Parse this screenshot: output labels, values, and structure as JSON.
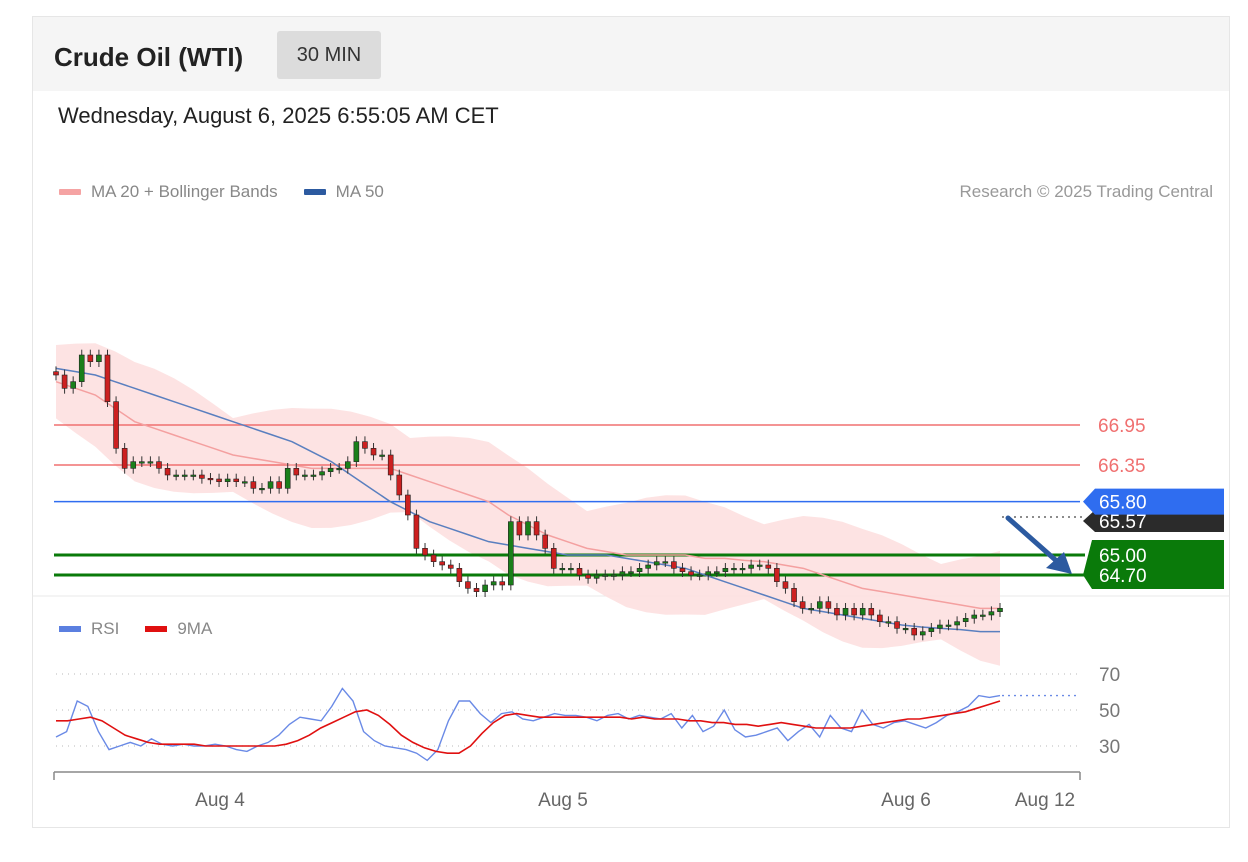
{
  "header": {
    "title": "Crude Oil (WTI)",
    "timeframe": "30 MIN"
  },
  "datetime": "Wednesday, August 6, 2025 6:55:05 AM CET",
  "legend": {
    "ma20": {
      "label": "MA 20 + Bollinger Bands",
      "color": "#f08080"
    },
    "ma50": {
      "label": "MA 50",
      "color": "#2c5aa0"
    }
  },
  "copyright": "Research © 2025 Trading Central",
  "rsi_legend": {
    "rsi": {
      "label": "RSI",
      "color": "#5b7fe0"
    },
    "ma9": {
      "label": "9MA",
      "color": "#e01010"
    }
  },
  "chart_data": [
    {
      "type": "candlestick",
      "ylim": [
        64.6,
        68.3
      ],
      "x_labels": [
        "Aug 4",
        "Aug 5",
        "Aug 6",
        "Aug 12"
      ],
      "levels": [
        {
          "value": 66.95,
          "label": "66.95",
          "kind": "resistance",
          "color": "#f07070"
        },
        {
          "value": 66.35,
          "label": "66.35",
          "kind": "resistance",
          "color": "#f07070"
        },
        {
          "value": 65.8,
          "label": "65.80",
          "kind": "pivot",
          "color": "#2f6df0"
        },
        {
          "value": 65.0,
          "label": "65.00",
          "kind": "support",
          "color": "#0a7a0a"
        },
        {
          "value": 64.7,
          "label": "64.70",
          "kind": "support",
          "color": "#0a7a0a"
        }
      ],
      "last_price": {
        "value": 65.57,
        "label": "65.57"
      },
      "close_series": [
        67.7,
        67.5,
        67.6,
        68.0,
        67.9,
        68.0,
        67.3,
        66.6,
        66.3,
        66.4,
        66.4,
        66.4,
        66.3,
        66.2,
        66.2,
        66.2,
        66.2,
        66.15,
        66.14,
        66.1,
        66.14,
        66.1,
        66.1,
        66.0,
        66.0,
        66.1,
        66.0,
        66.3,
        66.2,
        66.2,
        66.2,
        66.25,
        66.3,
        66.3,
        66.4,
        66.7,
        66.6,
        66.5,
        66.5,
        66.2,
        65.9,
        65.6,
        65.1,
        65.0,
        64.9,
        64.85,
        64.8,
        64.6,
        64.5,
        64.45,
        64.55,
        64.6,
        64.55,
        65.5,
        65.3,
        65.5,
        65.3,
        65.1,
        64.8,
        64.8,
        64.8,
        64.7,
        64.65,
        64.7,
        64.7,
        64.7,
        64.75,
        64.75,
        64.8,
        64.85,
        64.9,
        64.9,
        64.8,
        64.75,
        64.7,
        64.7,
        64.75,
        64.75,
        64.8,
        64.8,
        64.8,
        64.85,
        64.85,
        64.8,
        64.6,
        64.5,
        64.3,
        64.2,
        64.2,
        64.3,
        64.2,
        64.1,
        64.2,
        64.1,
        64.2,
        64.1,
        64.0,
        64.0,
        63.9,
        63.9,
        63.8,
        63.85,
        63.9,
        63.95,
        63.95,
        64.0,
        64.05,
        64.1,
        64.1,
        64.15,
        64.2
      ],
      "ma20_series": [
        67.6,
        67.5,
        67.4,
        67.2,
        67.0,
        66.9,
        66.8,
        66.7,
        66.6,
        66.5,
        66.45,
        66.4,
        66.35,
        66.3,
        66.3,
        66.3,
        66.3,
        66.3,
        66.2,
        66.1,
        66.0,
        65.9,
        65.8,
        65.6,
        65.45,
        65.3,
        65.2,
        65.1,
        65.05,
        65.0,
        65.0,
        65.0,
        65.0,
        64.95,
        64.95,
        64.92,
        64.9,
        64.85,
        64.8,
        64.7,
        64.6,
        64.5,
        64.45,
        64.4,
        64.35,
        64.3,
        64.25,
        64.2,
        64.2
      ],
      "ma50_series": [
        67.8,
        67.75,
        67.7,
        67.6,
        67.5,
        67.4,
        67.3,
        67.2,
        67.1,
        67.0,
        66.9,
        66.8,
        66.7,
        66.55,
        66.4,
        66.2,
        66.0,
        65.8,
        65.65,
        65.5,
        65.4,
        65.3,
        65.2,
        65.15,
        65.1,
        65.05,
        65.0,
        65.0,
        65.0,
        64.95,
        64.9,
        64.85,
        64.8,
        64.7,
        64.6,
        64.5,
        64.4,
        64.3,
        64.2,
        64.15,
        64.1,
        64.05,
        64.0,
        63.95,
        63.92,
        63.9,
        63.88,
        63.85,
        63.85
      ]
    },
    {
      "type": "line",
      "title": "RSI",
      "ylim": [
        20,
        75
      ],
      "y_ticks": [
        70,
        50,
        30
      ],
      "rsi_series": [
        35,
        38,
        55,
        52,
        38,
        28,
        30,
        32,
        30,
        34,
        31,
        30,
        31,
        30,
        30,
        31,
        30,
        28,
        27,
        30,
        32,
        36,
        42,
        46,
        45,
        44,
        52,
        62,
        55,
        38,
        33,
        30,
        29,
        28,
        26,
        22,
        28,
        44,
        55,
        55,
        48,
        43,
        48,
        49,
        45,
        44,
        46,
        48,
        47,
        47,
        46,
        44,
        47,
        48,
        45,
        47,
        46,
        45,
        48,
        40,
        47,
        38,
        41,
        50,
        39,
        35,
        36,
        38,
        40,
        33,
        38,
        42,
        35,
        47,
        40,
        38,
        50,
        42,
        40,
        43,
        44,
        42,
        40,
        43,
        47,
        49,
        52,
        58,
        57,
        58
      ],
      "ma9_series": [
        44,
        44,
        45,
        46,
        44,
        40,
        36,
        34,
        32,
        31,
        31,
        31,
        31,
        30,
        30,
        30,
        30,
        30,
        30,
        30,
        31,
        33,
        36,
        40,
        43,
        46,
        49,
        50,
        47,
        42,
        36,
        32,
        29,
        27,
        26,
        26,
        30,
        37,
        43,
        47,
        48,
        47,
        46,
        46,
        46,
        46,
        46,
        46,
        46,
        46,
        45,
        46,
        45,
        45,
        45,
        44,
        44,
        43,
        43,
        42,
        42,
        41,
        42,
        43,
        42,
        41,
        40,
        40,
        40,
        40,
        41,
        42,
        43,
        44,
        45,
        45,
        46,
        47,
        48,
        49,
        51,
        53,
        55
      ]
    }
  ]
}
